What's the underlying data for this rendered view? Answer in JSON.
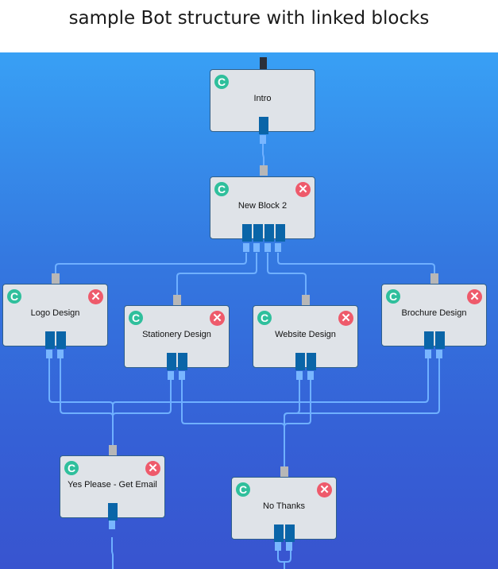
{
  "title": "sample Bot structure with linked blocks",
  "icons": {
    "connect": "C",
    "delete": "✕"
  },
  "colors": {
    "canvas_top": "#38a0f5",
    "canvas_bottom": "#3854cf",
    "block_bg": "#dfe3e8",
    "connect_icon": "#2fbf9c",
    "delete_icon": "#ee5a6b",
    "output_port": "#0a65a8",
    "output_pin": "#78b6ff",
    "input_port": "#b7b7b7",
    "wire": "#6fb0ff"
  },
  "blocks": [
    {
      "id": "intro",
      "label": "Intro",
      "deletable": false,
      "outputs": 1
    },
    {
      "id": "new-block-2",
      "label": "New Block 2",
      "deletable": true,
      "outputs": 4
    },
    {
      "id": "logo-design",
      "label": "Logo Design",
      "deletable": true,
      "outputs": 2
    },
    {
      "id": "stationery-design",
      "label": "Stationery Design",
      "deletable": true,
      "outputs": 2
    },
    {
      "id": "website-design",
      "label": "Website Design",
      "deletable": true,
      "outputs": 2
    },
    {
      "id": "brochure-design",
      "label": "Brochure Design",
      "deletable": true,
      "outputs": 2
    },
    {
      "id": "yes-please",
      "label": "Yes Please - Get Email",
      "deletable": true,
      "outputs": 1
    },
    {
      "id": "no-thanks",
      "label": "No Thanks",
      "deletable": true,
      "outputs": 2
    }
  ],
  "links": [
    {
      "from": "intro",
      "port": 1,
      "to": "new-block-2"
    },
    {
      "from": "new-block-2",
      "port": 1,
      "to": "logo-design"
    },
    {
      "from": "new-block-2",
      "port": 2,
      "to": "stationery-design"
    },
    {
      "from": "new-block-2",
      "port": 3,
      "to": "website-design"
    },
    {
      "from": "new-block-2",
      "port": 4,
      "to": "brochure-design"
    },
    {
      "from": "logo-design",
      "port": 1,
      "to": "yes-please"
    },
    {
      "from": "logo-design",
      "port": 2,
      "to": "yes-please"
    },
    {
      "from": "stationery-design",
      "port": 1,
      "to": "yes-please"
    },
    {
      "from": "stationery-design",
      "port": 2,
      "to": "no-thanks"
    },
    {
      "from": "website-design",
      "port": 1,
      "to": "no-thanks"
    },
    {
      "from": "website-design",
      "port": 2,
      "to": "no-thanks"
    },
    {
      "from": "brochure-design",
      "port": 1,
      "to": "yes-please"
    },
    {
      "from": "brochure-design",
      "port": 2,
      "to": "yes-please"
    }
  ]
}
